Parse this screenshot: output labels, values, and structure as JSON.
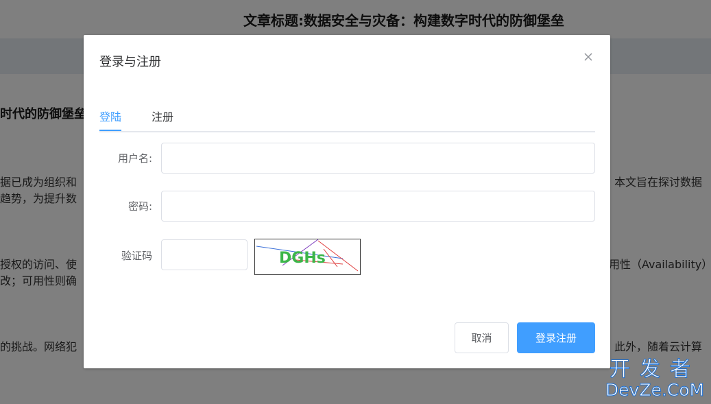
{
  "page": {
    "title": "文章标题:数据安全与灾备：构建数字时代的防御堡垒",
    "subhead": "时代的防御堡垒",
    "fragments": {
      "p1_left": "据已成为组织和",
      "p1_right": "。本文旨在探讨数据",
      "p2_left": "趋势，为提升数",
      "p3_left": "授权的访问、使",
      "p3_right": "用性（Availability）",
      "p4_left": "改；可用性则确",
      "p5_left": "的挑战。网络犯",
      "p5_right": "。此外，随着云计算"
    }
  },
  "dialog": {
    "title": "登录与注册",
    "tabs": [
      {
        "label": "登陆",
        "active": true
      },
      {
        "label": "注册",
        "active": false
      }
    ],
    "form": {
      "username_label": "用户名:",
      "username_value": "",
      "password_label": "密码:",
      "password_value": "",
      "captcha_label": "验证码",
      "captcha_value": "",
      "captcha_text": "DGHs"
    },
    "buttons": {
      "cancel": "取消",
      "submit": "登录注册"
    }
  },
  "colors": {
    "primary": "#409eff",
    "captcha_text": "#3cb64a"
  },
  "watermark": {
    "cn": "开发者",
    "en": "DevZe.CoM"
  }
}
